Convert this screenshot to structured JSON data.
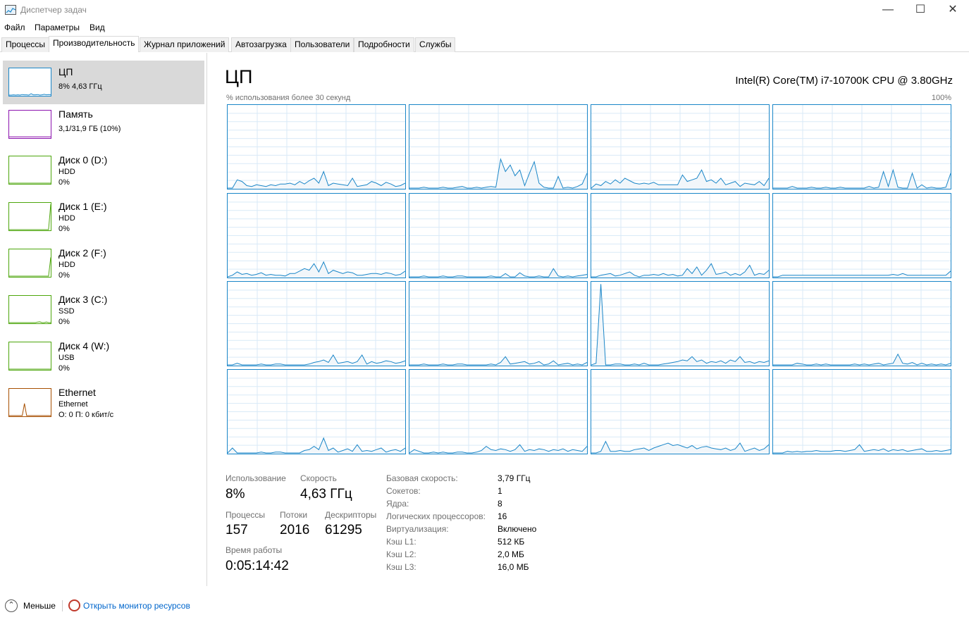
{
  "window": {
    "title": "Диспетчер задач",
    "minimize_glyph": "—",
    "maximize_glyph": "☐",
    "close_glyph": "✕"
  },
  "menu": [
    "Файл",
    "Параметры",
    "Вид"
  ],
  "tabs": [
    "Процессы",
    "Производительность",
    "Журнал приложений",
    "Автозагрузка",
    "Пользователи",
    "Подробности",
    "Службы"
  ],
  "active_tab": "Производительность",
  "sidebar": {
    "items": [
      {
        "name": "ЦП",
        "line1": "8% 4,63 ГГц",
        "line2": "",
        "color": "#1a86c8",
        "active": true,
        "icon": "cpu-thumbnail"
      },
      {
        "name": "Память",
        "line1": "3,1/31,9 ГБ (10%)",
        "line2": "",
        "color": "#8b12ae",
        "active": false,
        "icon": "memory-thumbnail"
      },
      {
        "name": "Диск 0 (D:)",
        "line1": "HDD",
        "line2": "0%",
        "color": "#4da60c",
        "active": false,
        "icon": "disk-thumbnail"
      },
      {
        "name": "Диск 1 (E:)",
        "line1": "HDD",
        "line2": "0%",
        "color": "#4da60c",
        "active": false,
        "icon": "disk-thumbnail"
      },
      {
        "name": "Диск 2 (F:)",
        "line1": "HDD",
        "line2": "0%",
        "color": "#4da60c",
        "active": false,
        "icon": "disk-thumbnail"
      },
      {
        "name": "Диск 3 (C:)",
        "line1": "SSD",
        "line2": "0%",
        "color": "#4da60c",
        "active": false,
        "icon": "disk-thumbnail"
      },
      {
        "name": "Диск 4 (W:)",
        "line1": "USB",
        "line2": "0%",
        "color": "#4da60c",
        "active": false,
        "icon": "disk-thumbnail"
      },
      {
        "name": "Ethernet",
        "line1": "Ethernet",
        "line2": "О: 0 П: 0 кбит/с",
        "color": "#a74f01",
        "active": false,
        "icon": "network-thumbnail"
      }
    ]
  },
  "cpu": {
    "title": "ЦП",
    "model": "Intel(R) Core(TM) i7-10700K CPU @ 3.80GHz",
    "graph_label": "% использования более 30 секунд",
    "graph_max": "100%",
    "line_color": "#1a86c8",
    "grid_color": "#d9eaf7",
    "cores": [
      [
        0,
        0,
        10,
        8,
        3,
        2,
        4,
        3,
        2,
        4,
        3,
        5,
        5,
        6,
        4,
        8,
        5,
        9,
        12,
        6,
        20,
        3,
        6,
        5,
        4,
        3,
        12,
        2,
        3,
        4,
        8,
        6,
        3,
        7,
        5,
        2,
        3,
        6
      ],
      [
        0,
        0,
        0,
        1,
        0,
        0,
        0,
        1,
        0,
        0,
        1,
        2,
        0,
        0,
        1,
        0,
        1,
        2,
        1,
        35,
        20,
        28,
        15,
        22,
        3,
        18,
        32,
        6,
        1,
        0,
        0,
        14,
        0,
        1,
        0,
        2,
        5,
        18
      ],
      [
        0,
        5,
        3,
        8,
        5,
        10,
        6,
        12,
        9,
        6,
        5,
        6,
        5,
        7,
        4,
        4,
        4,
        4,
        4,
        16,
        8,
        10,
        12,
        22,
        8,
        10,
        6,
        12,
        4,
        6,
        8,
        2,
        6,
        5,
        4,
        8,
        3,
        12
      ],
      [
        0,
        0,
        0,
        0,
        2,
        0,
        0,
        0,
        1,
        0,
        0,
        1,
        0,
        0,
        1,
        0,
        0,
        0,
        0,
        0,
        2,
        0,
        1,
        20,
        2,
        22,
        1,
        0,
        0,
        18,
        0,
        4,
        0,
        1,
        0,
        0,
        1,
        18
      ],
      [
        0,
        2,
        6,
        3,
        4,
        2,
        3,
        5,
        2,
        3,
        2,
        2,
        1,
        4,
        4,
        7,
        10,
        8,
        16,
        6,
        18,
        4,
        8,
        6,
        4,
        6,
        5,
        2,
        2,
        3,
        4,
        4,
        3,
        5,
        4,
        2,
        3,
        7
      ],
      [
        0,
        0,
        0,
        1,
        0,
        0,
        0,
        1,
        0,
        0,
        1,
        1,
        0,
        0,
        0,
        0,
        0,
        1,
        0,
        0,
        4,
        0,
        0,
        5,
        1,
        0,
        0,
        1,
        0,
        0,
        10,
        1,
        0,
        1,
        0,
        1,
        2,
        3
      ],
      [
        0,
        0,
        2,
        3,
        4,
        1,
        2,
        4,
        6,
        2,
        0,
        2,
        2,
        3,
        2,
        4,
        2,
        3,
        1,
        2,
        10,
        4,
        12,
        2,
        8,
        16,
        3,
        4,
        6,
        2,
        4,
        2,
        6,
        14,
        2,
        4,
        3,
        8
      ],
      [
        0,
        0,
        2,
        2,
        2,
        2,
        2,
        2,
        2,
        2,
        2,
        2,
        2,
        2,
        2,
        2,
        2,
        2,
        2,
        2,
        2,
        2,
        2,
        2,
        2,
        3,
        2,
        4,
        2,
        2,
        2,
        2,
        2,
        2,
        2,
        2,
        2,
        7
      ],
      [
        0,
        0,
        2,
        0,
        0,
        0,
        0,
        1,
        0,
        0,
        1,
        1,
        0,
        0,
        0,
        0,
        0,
        1,
        3,
        4,
        6,
        3,
        12,
        2,
        3,
        4,
        2,
        4,
        12,
        1,
        4,
        2,
        3,
        5,
        4,
        2,
        3,
        5
      ],
      [
        0,
        0,
        0,
        1,
        0,
        0,
        0,
        1,
        0,
        0,
        1,
        1,
        0,
        0,
        0,
        0,
        0,
        1,
        0,
        3,
        10,
        1,
        2,
        3,
        4,
        1,
        2,
        4,
        0,
        1,
        5,
        0,
        1,
        2,
        0,
        1,
        0,
        3
      ],
      [
        0,
        2,
        98,
        0,
        0,
        1,
        1,
        0,
        0,
        1,
        0,
        2,
        0,
        0,
        0,
        1,
        2,
        3,
        4,
        6,
        5,
        10,
        4,
        6,
        2,
        4,
        3,
        5,
        2,
        6,
        4,
        10,
        3,
        4,
        2,
        4,
        3,
        5
      ],
      [
        0,
        0,
        0,
        0,
        0,
        2,
        1,
        0,
        0,
        1,
        0,
        1,
        0,
        0,
        0,
        0,
        0,
        1,
        0,
        1,
        0,
        1,
        2,
        0,
        1,
        2,
        13,
        2,
        1,
        3,
        0,
        2,
        0,
        1,
        0,
        1,
        0,
        2
      ],
      [
        0,
        6,
        0,
        0,
        0,
        0,
        0,
        1,
        0,
        0,
        1,
        1,
        0,
        0,
        0,
        0,
        3,
        4,
        8,
        4,
        18,
        3,
        6,
        1,
        3,
        5,
        2,
        10,
        2,
        3,
        2,
        4,
        6,
        1,
        3,
        4,
        2,
        6
      ],
      [
        0,
        4,
        2,
        0,
        0,
        1,
        0,
        1,
        0,
        0,
        1,
        1,
        0,
        0,
        1,
        3,
        8,
        4,
        3,
        5,
        4,
        2,
        4,
        10,
        2,
        4,
        3,
        5,
        4,
        2,
        4,
        3,
        5,
        2,
        4,
        3,
        2,
        8
      ],
      [
        0,
        0,
        2,
        14,
        2,
        2,
        3,
        2,
        2,
        4,
        5,
        6,
        3,
        6,
        8,
        10,
        12,
        9,
        10,
        8,
        6,
        9,
        5,
        7,
        8,
        6,
        5,
        4,
        6,
        3,
        5,
        12,
        2,
        4,
        6,
        3,
        5,
        10
      ],
      [
        0,
        0,
        0,
        2,
        1,
        2,
        1,
        2,
        2,
        3,
        2,
        2,
        2,
        3,
        3,
        2,
        3,
        4,
        10,
        2,
        3,
        4,
        3,
        5,
        2,
        4,
        3,
        4,
        2,
        3,
        4,
        5,
        2,
        2,
        3,
        2,
        3,
        4
      ]
    ]
  },
  "stats": {
    "usage_label": "Использование",
    "usage_value": "8%",
    "speed_label": "Скорость",
    "speed_value": "4,63 ГГц",
    "processes_label": "Процессы",
    "processes_value": "157",
    "threads_label": "Потоки",
    "threads_value": "2016",
    "handles_label": "Дескрипторы",
    "handles_value": "61295",
    "uptime_label": "Время работы",
    "uptime_value": "0:05:14:42"
  },
  "info": [
    {
      "key": "Базовая скорость:",
      "value": "3,79 ГГц"
    },
    {
      "key": "Сокетов:",
      "value": "1"
    },
    {
      "key": "Ядра:",
      "value": "8"
    },
    {
      "key": "Логических процессоров:",
      "value": "16"
    },
    {
      "key": "Виртуализация:",
      "value": "Включено"
    },
    {
      "key": "Кэш L1:",
      "value": "512 КБ"
    },
    {
      "key": "Кэш L2:",
      "value": "2,0 МБ"
    },
    {
      "key": "Кэш L3:",
      "value": "16,0 МБ"
    }
  ],
  "footer": {
    "fewer_label": "Меньше",
    "fewer_glyph": "⌃",
    "resmon_label": "Открыть монитор ресурсов"
  }
}
